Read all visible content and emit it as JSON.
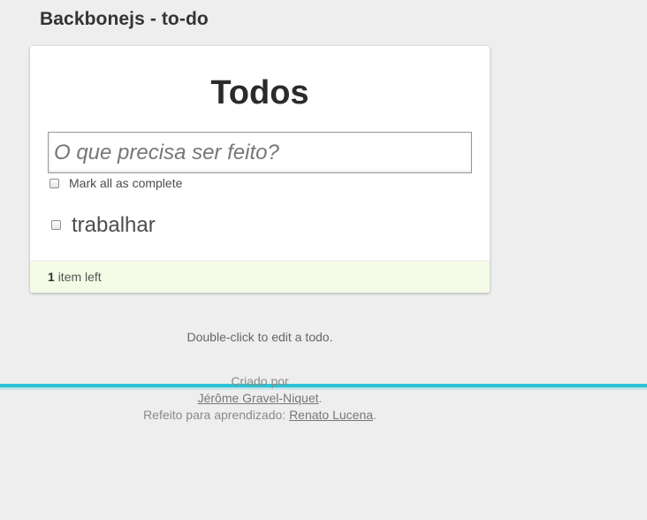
{
  "header": {
    "title": "Backbonejs - to-do"
  },
  "app": {
    "title": "Todos",
    "new_todo_placeholder": "O que precisa ser feito?",
    "new_todo_value": "",
    "toggle_all_label": "Mark all as complete",
    "toggle_all_checked": false,
    "todos": [
      {
        "label": "trabalhar",
        "completed": false
      }
    ],
    "footer": {
      "count": "1",
      "count_suffix": "item left"
    }
  },
  "info": {
    "hint": "Double-click to edit a todo.",
    "created_by": "Criado por",
    "author_name": "Jérôme Gravel-Niquet",
    "author_suffix": ".",
    "remade_prefix": "Refeito para aprendizado:",
    "remade_name": "Renato Lucena",
    "remade_suffix": "."
  },
  "colors": {
    "background": "#eeeeee",
    "footer_bg": "#f3fbe6",
    "accent_bar": "#2dc3d6"
  }
}
